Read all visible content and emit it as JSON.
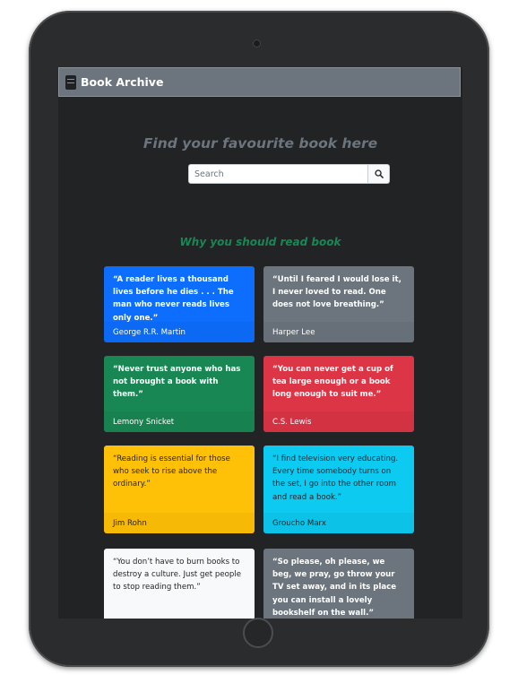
{
  "app": {
    "brand": "Book Archive"
  },
  "hero": {
    "title": "Find your favourite book here"
  },
  "search": {
    "placeholder": "Search"
  },
  "section": {
    "title": "Why you should read book"
  },
  "quotes": [
    {
      "text": "“A reader lives a thousand lives before he dies . . . The man who never reads lives only one.”",
      "author": "George R.R. Martin"
    },
    {
      "text": "“Until I feared I would lose it, I never loved to read. One does not love breathing.”",
      "author": "Harper Lee"
    },
    {
      "text": "“Never trust anyone who has not brought a book with them.”",
      "author": "Lemony Snicket"
    },
    {
      "text": "“You can never get a cup of tea large enough or a book long enough to suit me.”",
      "author": "C.S. Lewis"
    },
    {
      "text": "“Reading is essential for those who seek to rise above the ordinary.”",
      "author": "Jim Rohn"
    },
    {
      "text": "“I find television very educating. Every time somebody turns on the set, I go into the other room and read a book.”",
      "author": "Groucho Marx"
    },
    {
      "text": "“You don’t have to burn books to destroy a culture. Just get people to stop reading them.”",
      "author": ""
    },
    {
      "text": "“So please, oh please, we beg, we pray, go throw your TV set away, and in its place you can install a lovely bookshelf on the wall.”",
      "author": ""
    }
  ],
  "icons": {
    "brand": "book-icon",
    "search": "search-icon"
  },
  "colors": {
    "primary": "#0d6efd",
    "secondary": "#6c757d",
    "success": "#198754",
    "danger": "#dc3545",
    "warning": "#ffc107",
    "info": "#0dcaf0",
    "light": "#f8f9fa",
    "background": "#212325"
  }
}
